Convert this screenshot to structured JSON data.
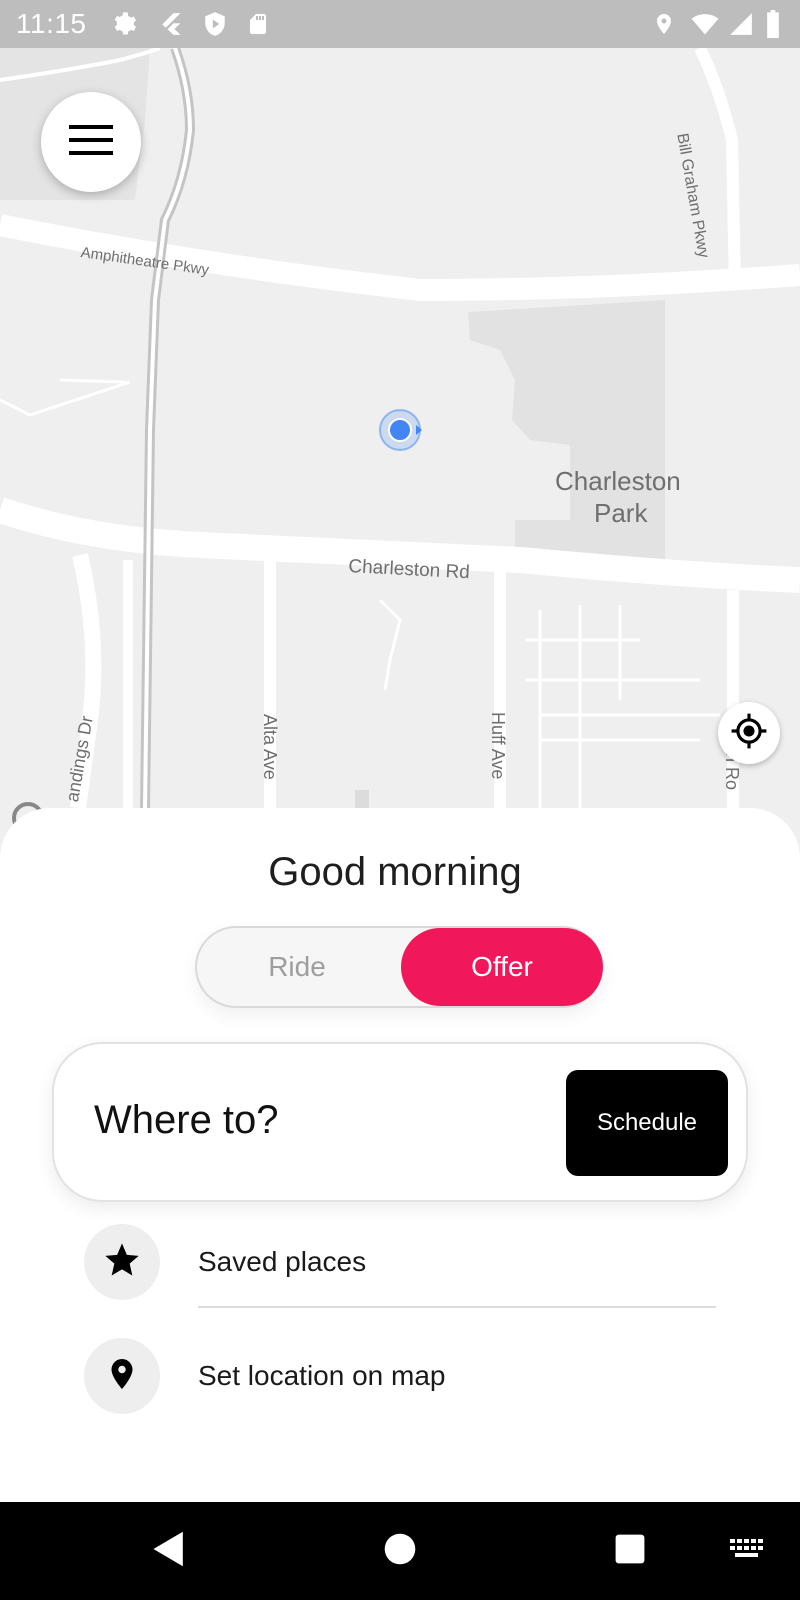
{
  "status_bar": {
    "time": "11:15",
    "left_icons": [
      "settings-icon",
      "flutter-icon",
      "play-protect-icon",
      "sd-card-icon"
    ],
    "right_icons": [
      "location-icon",
      "wifi-icon",
      "signal-icon",
      "battery-icon"
    ]
  },
  "map": {
    "labels": {
      "amphitheatre": "Amphitheatre Pkwy",
      "bill_graham": "Bill Graham Pkwy",
      "charleston_park_line1": "Charleston",
      "charleston_park_line2": "Park",
      "charleston_rd": "Charleston Rd",
      "landings": "andings Dr",
      "alta": "Alta Ave",
      "huff": "Huff Ave",
      "right_edge": "uin Ro"
    },
    "icons": {
      "menu": "hamburger-menu-icon",
      "locate": "my-location-icon",
      "user": "user-location-dot"
    }
  },
  "sheet": {
    "greeting": "Good morning",
    "toggle": {
      "ride_label": "Ride",
      "offer_label": "Offer",
      "selected": "Offer"
    },
    "search": {
      "label": "Where to?",
      "schedule_label": "Schedule"
    },
    "items": [
      {
        "label": "Saved places",
        "icon": "star-icon"
      },
      {
        "label": "Set location on map",
        "icon": "map-pin-icon"
      }
    ]
  },
  "nav_bar": {
    "buttons": [
      "back-icon",
      "home-icon",
      "recents-icon",
      "keyboard-icon"
    ]
  },
  "colors": {
    "accent": "#f0185a",
    "schedule_bg": "#000000",
    "user_dot": "#4285f4"
  }
}
